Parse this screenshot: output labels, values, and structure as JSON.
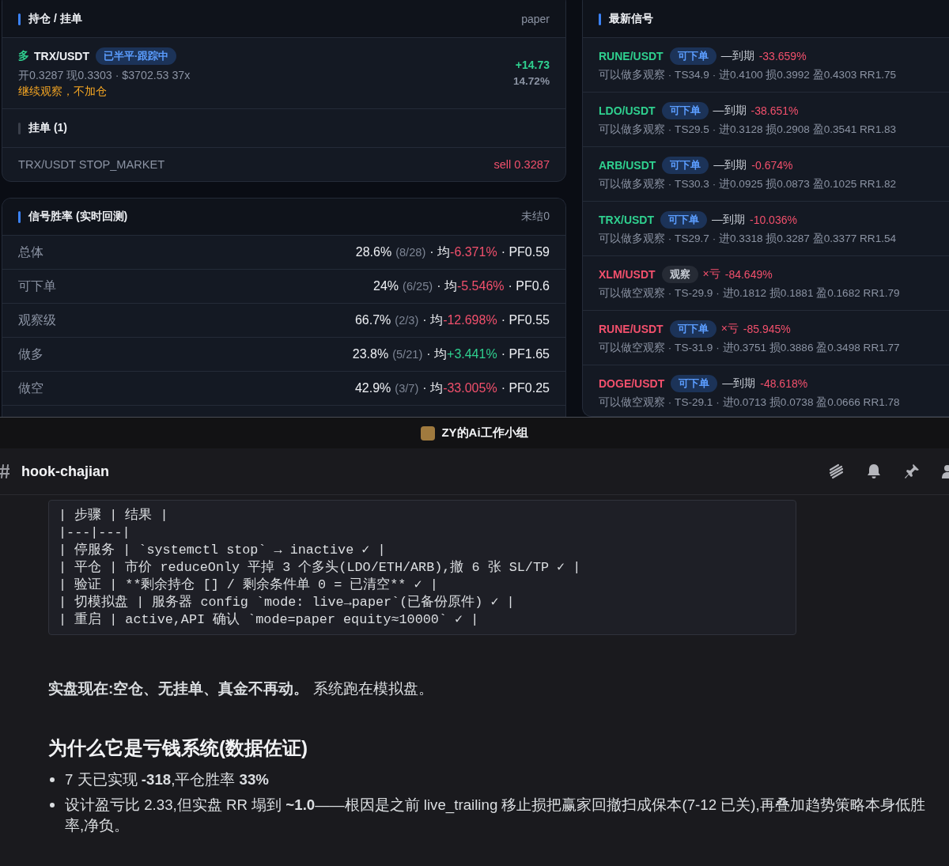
{
  "positions_panel": {
    "title": "持仓 / 挂单",
    "mode": "paper",
    "positions": [
      {
        "side": "多",
        "long": true,
        "symbol": "TRX/USDT",
        "status": "已半平·跟踪中",
        "details": "开0.3287 现0.3303 · $3702.53 37x",
        "note": "继续观察，不加仓",
        "pnl": "+14.73",
        "profit": true,
        "pnl_pct": "14.72%"
      }
    ],
    "orders_title": "挂单 (1)",
    "orders": [
      {
        "name": "TRX/USDT STOP_MARKET",
        "action": "sell 0.3287",
        "sell": true
      }
    ]
  },
  "winrate_panel": {
    "title": "信号胜率 (实时回测)",
    "open_count": "未结0",
    "rows": [
      {
        "label": "总体",
        "rate": "28.6%",
        "sample": "(8/28)",
        "avg_label": "· 均",
        "avg": "-6.371%",
        "gain": false,
        "pf": "· PF0.59"
      },
      {
        "label": "可下单",
        "rate": "24%",
        "sample": "(6/25)",
        "avg_label": "· 均",
        "avg": "-5.546%",
        "gain": false,
        "pf": "· PF0.6"
      },
      {
        "label": "观察级",
        "rate": "66.7%",
        "sample": "(2/3)",
        "avg_label": "· 均",
        "avg": "-12.698%",
        "gain": false,
        "pf": "· PF0.55"
      },
      {
        "label": "做多",
        "rate": "23.8%",
        "sample": "(5/21)",
        "avg_label": "· 均",
        "avg": "+3.441%",
        "gain": true,
        "pf": "· PF1.65"
      },
      {
        "label": "做空",
        "rate": "42.9%",
        "sample": "(3/7)",
        "avg_label": "· 均",
        "avg": "-33.005%",
        "gain": false,
        "pf": "· PF0.25"
      }
    ]
  },
  "signals_panel": {
    "title": "最新信号",
    "signals": [
      {
        "symbol": "RUNE/USDT",
        "long": true,
        "grade": "可下单",
        "kind": "order",
        "outcome": "—到期",
        "expired": true,
        "result": "-33.659%",
        "detail": "可以做多观察 · TS34.9 · 进0.4100 损0.3992 盈0.4303 RR1.75"
      },
      {
        "symbol": "LDO/USDT",
        "long": true,
        "grade": "可下单",
        "kind": "order",
        "outcome": "—到期",
        "expired": true,
        "result": "-38.651%",
        "detail": "可以做多观察 · TS29.5 · 进0.3128 损0.2908 盈0.3541 RR1.83"
      },
      {
        "symbol": "ARB/USDT",
        "long": true,
        "grade": "可下单",
        "kind": "order",
        "outcome": "—到期",
        "expired": true,
        "result": "-0.674%",
        "detail": "可以做多观察 · TS30.3 · 进0.0925 损0.0873 盈0.1025 RR1.82"
      },
      {
        "symbol": "TRX/USDT",
        "long": true,
        "grade": "可下单",
        "kind": "order",
        "outcome": "—到期",
        "expired": true,
        "result": "-10.036%",
        "detail": "可以做多观察 · TS29.7 · 进0.3318 损0.3287 盈0.3377 RR1.54"
      },
      {
        "symbol": "XLM/USDT",
        "long": false,
        "grade": "观察",
        "kind": "watch",
        "outcome": "×亏",
        "expired": false,
        "result": "-84.649%",
        "detail": "可以做空观察 · TS-29.9 · 进0.1812 损0.1881 盈0.1682 RR1.79"
      },
      {
        "symbol": "RUNE/USDT",
        "long": false,
        "grade": "可下单",
        "kind": "order",
        "outcome": "×亏",
        "expired": false,
        "result": "-85.945%",
        "detail": "可以做空观察 · TS-31.9 · 进0.3751 损0.3886 盈0.3498 RR1.77"
      },
      {
        "symbol": "DOGE/USDT",
        "long": false,
        "grade": "可下单",
        "kind": "order",
        "outcome": "—到期",
        "expired": true,
        "result": "-48.618%",
        "detail": "可以做空观察 · TS-29.1 · 进0.0713 损0.0738 盈0.0666 RR1.78"
      }
    ]
  },
  "chat": {
    "server_name": "ZY的Ai工作小组",
    "channel": "hook-chajian",
    "code_lines": [
      "| 步骤 | 结果 |",
      "|---|---|",
      "| 停服务 | `systemctl stop` → inactive ✓ |",
      "| 平仓 | 市价 reduceOnly 平掉 3 个多头(LDO/ETH/ARB),撤 6 张 SL/TP ✓ |",
      "| 验证 | **剩余持仓 [] / 剩余条件单 0 = 已清空** ✓ |",
      "| 切模拟盘 | 服务器 config `mode: live→paper`(已备份原件) ✓ |",
      "| 重启 | active,API 确认 `mode=paper equity≈10000` ✓ |"
    ],
    "status_line": "**实盘现在:空仓、无挂单、真金不再动。** 系统跑在模拟盘。",
    "heading": "为什么它是亏钱系统(数据佐证)",
    "bullets": [
      "7 天已实现 **-318**,平仓胜率 **33%**",
      "设计盈亏比 2.33,但实盘 RR 塌到 **~1.0**——根因是之前 live_trailing 移止损把赢家回撤扫成保本(7-12 已关),再叠加趋势策略本身低胜率,净负。"
    ]
  }
}
